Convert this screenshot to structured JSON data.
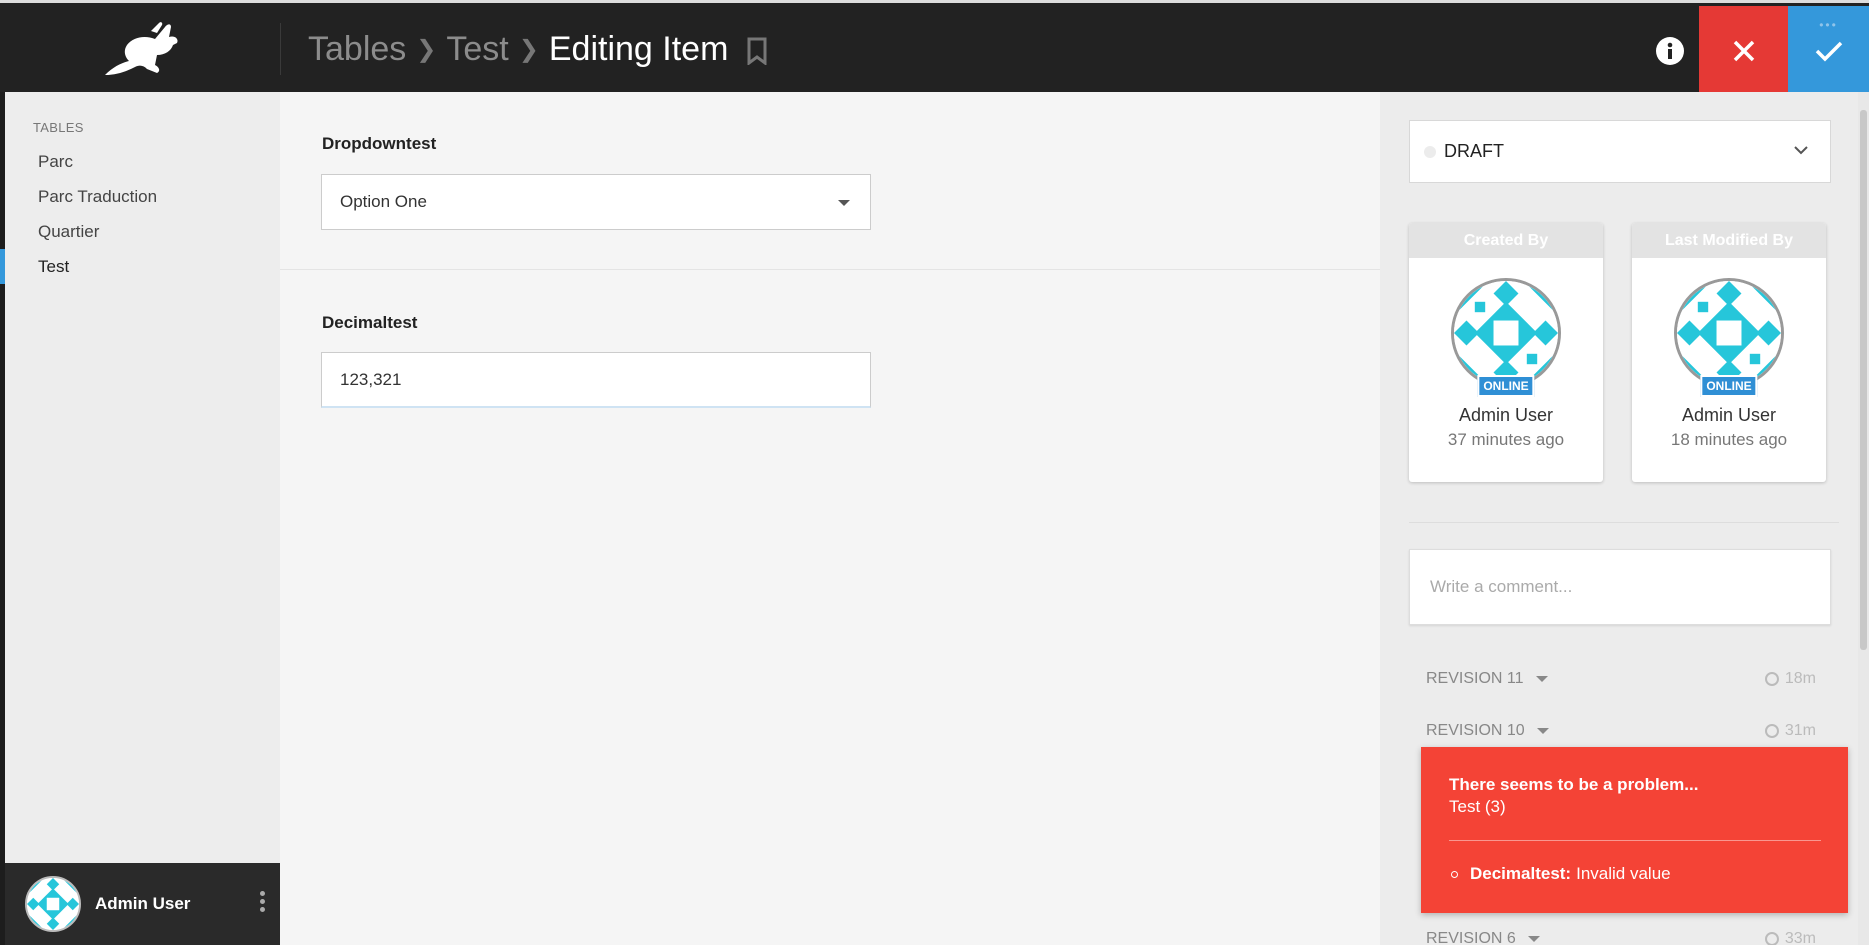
{
  "header": {
    "breadcrumb": [
      "Tables",
      "Test",
      "Editing Item"
    ],
    "icons": {
      "logo": "rabbit-logo",
      "bookmark": "bookmark-icon",
      "info": "info-icon",
      "close": "close-icon",
      "save": "check-icon"
    },
    "colors": {
      "bar": "#222222",
      "close": "#e53935",
      "save": "#3498db"
    }
  },
  "sidebar": {
    "heading": "TABLES",
    "items": [
      {
        "label": "Parc"
      },
      {
        "label": "Parc Traduction"
      },
      {
        "label": "Quartier"
      },
      {
        "label": "Test",
        "active": true
      }
    ],
    "user": {
      "name": "Admin User"
    }
  },
  "form": {
    "dropdown": {
      "label": "Dropdowntest",
      "value": "Option One"
    },
    "decimal": {
      "label": "Decimaltest",
      "value": "123,321"
    }
  },
  "panel": {
    "status": "DRAFT",
    "created": {
      "heading": "Created By",
      "badge": "ONLINE",
      "name": "Admin User",
      "time": "37 minutes ago"
    },
    "modified": {
      "heading": "Last Modified By",
      "badge": "ONLINE",
      "name": "Admin User",
      "time": "18 minutes ago"
    },
    "comment_placeholder": "Write a comment...",
    "revisions": [
      {
        "label": "REVISION 11",
        "time": "18m"
      },
      {
        "label": "REVISION 10",
        "time": "31m"
      },
      {
        "label": "REVISION 6",
        "time": "33m"
      }
    ]
  },
  "error": {
    "title": "There seems to be a problem...",
    "subtitle": "Test (3)",
    "field": "Decimaltest:",
    "message": "Invalid value",
    "color": "#f44336"
  }
}
